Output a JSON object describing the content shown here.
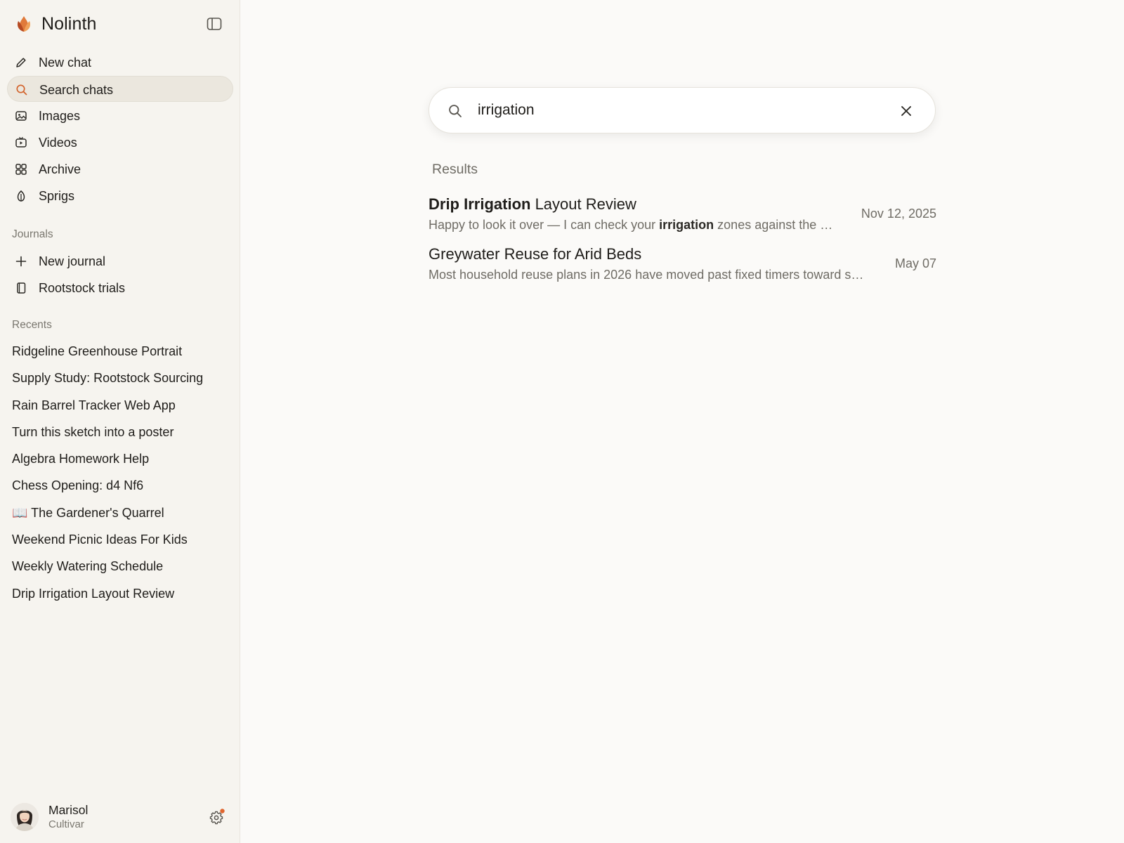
{
  "brand": {
    "name": "Nolinth",
    "logo_icon": "flame-leaf-logo-icon",
    "accent_color": "#e0662f"
  },
  "sidebar": {
    "toggle_icon": "sidebar-toggle-icon",
    "nav": [
      {
        "label": "New chat",
        "icon": "pencil-icon",
        "active": false
      },
      {
        "label": "Search chats",
        "icon": "search-icon",
        "active": true
      },
      {
        "label": "Images",
        "icon": "image-icon",
        "active": false
      },
      {
        "label": "Videos",
        "icon": "video-icon",
        "active": false
      },
      {
        "label": "Archive",
        "icon": "grid-icon",
        "active": false
      },
      {
        "label": "Sprigs",
        "icon": "leaf-icon",
        "active": false
      }
    ],
    "journals_heading": "Journals",
    "journals": [
      {
        "label": "New journal",
        "icon": "plus-icon"
      },
      {
        "label": "Rootstock trials",
        "icon": "notebook-icon"
      }
    ],
    "recents_heading": "Recents",
    "recents": [
      "Ridgeline Greenhouse Portrait",
      "Supply Study: Rootstock Sourcing",
      "Rain Barrel Tracker Web App",
      "Turn this sketch into a poster",
      "Algebra Homework Help",
      "Chess Opening: d4 Nf6",
      "📖 The Gardener's Quarrel",
      "Weekend Picnic Ideas For Kids",
      "Weekly Watering Schedule",
      "Drip Irrigation Layout Review"
    ],
    "profile": {
      "name": "Marisol",
      "plan": "Cultivar",
      "settings_icon": "gear-icon",
      "notification_color": "#e0662f"
    }
  },
  "search": {
    "value": "irrigation",
    "placeholder": "Search chats",
    "clear_icon": "close-icon"
  },
  "results": {
    "label": "Results",
    "items": [
      {
        "title_bold": "Drip Irrigation",
        "title_rest": " Layout Review",
        "snippet_before": "Happy to look it over — I can check your ",
        "snippet_bold": "irrigation",
        "snippet_after": " zones against the …",
        "date": "Nov 12, 2025"
      },
      {
        "title_bold": "",
        "title_rest": "Greywater Reuse for Arid Beds",
        "snippet_before": "Most household reuse plans in 2026 have moved past fixed timers toward s…",
        "snippet_bold": "",
        "snippet_after": "",
        "date": "May 07"
      }
    ]
  }
}
